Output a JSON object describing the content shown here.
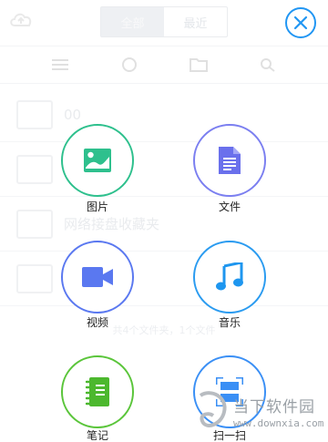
{
  "background": {
    "tabs": [
      "全部",
      "最近"
    ],
    "rows": [
      {
        "name": "00"
      },
      {
        "name": ""
      },
      {
        "name": "网络接盘收藏夹"
      },
      {
        "name": ""
      }
    ],
    "footer_text": "共4个文件夹，1个文件"
  },
  "actions": [
    {
      "label": "图片",
      "color": "#2ec08d",
      "icon": "image-icon"
    },
    {
      "label": "文件",
      "color": "#7b7ff0",
      "icon": "document-icon"
    },
    {
      "label": "视频",
      "color": "#5a78f0",
      "icon": "video-camera-icon"
    },
    {
      "label": "音乐",
      "color": "#2a9bf0",
      "icon": "music-note-icon"
    },
    {
      "label": "笔记",
      "color": "#5ac53a",
      "icon": "notebook-icon"
    },
    {
      "label": "扫一扫",
      "color": "#3a8ff5",
      "icon": "scan-icon"
    }
  ],
  "close_icon": "close-icon",
  "watermark": {
    "text": "当下软件园",
    "url": "www.downxia.com"
  }
}
